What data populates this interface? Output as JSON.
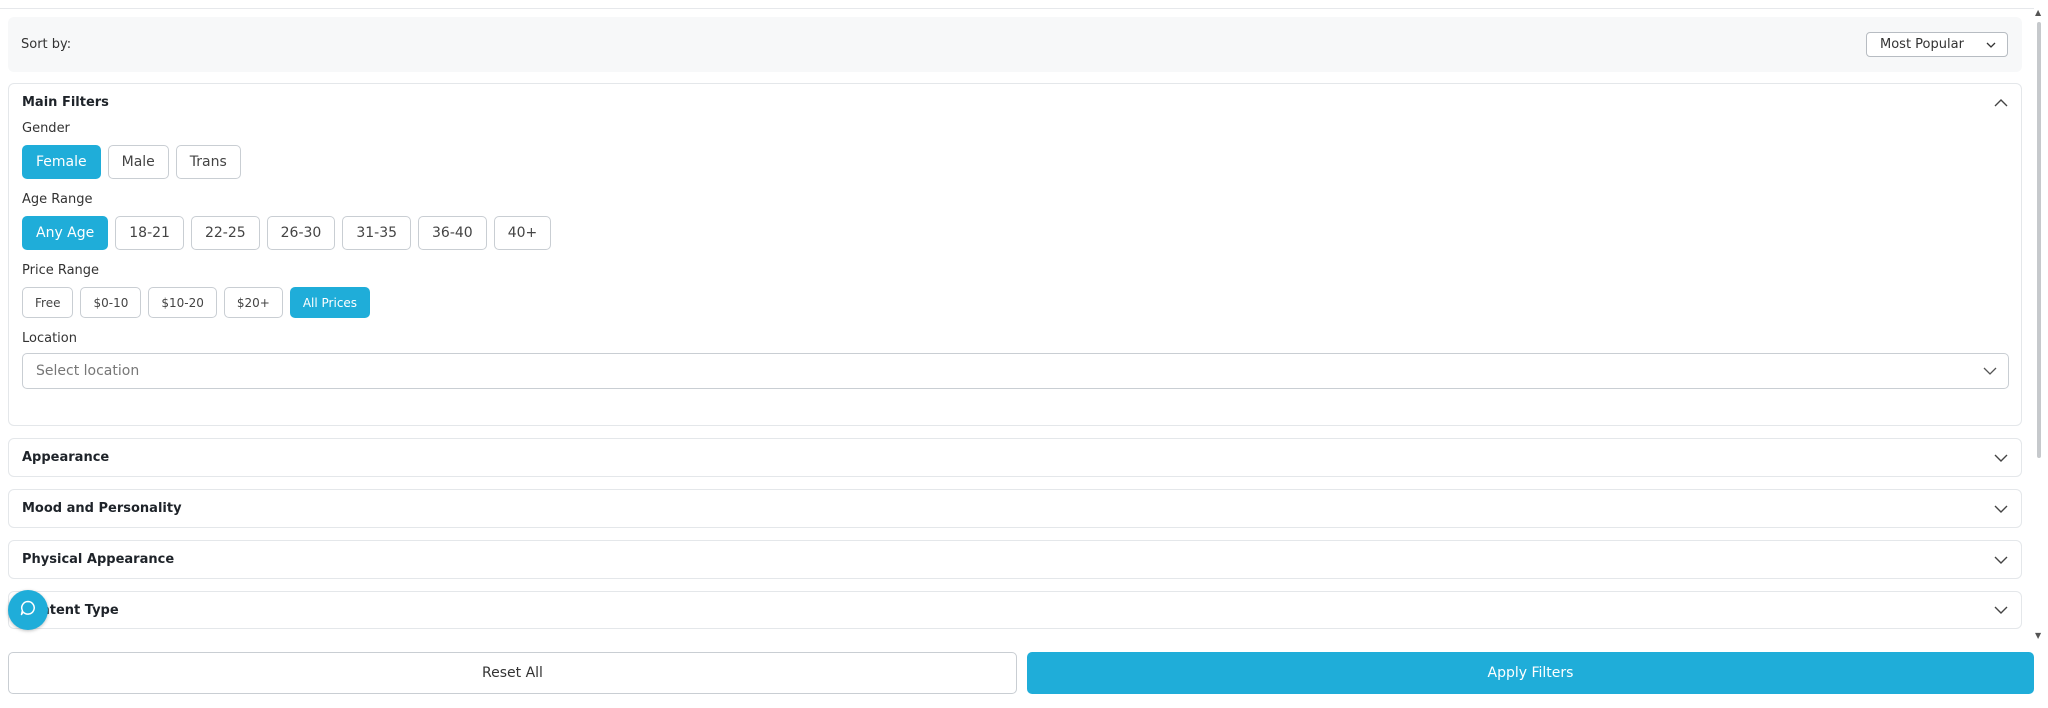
{
  "sort": {
    "label": "Sort by:",
    "selected": "Most Popular"
  },
  "main_filters": {
    "title": "Main Filters",
    "gender": {
      "label": "Gender",
      "options": [
        "Female",
        "Male",
        "Trans"
      ],
      "selected": "Female"
    },
    "age": {
      "label": "Age Range",
      "options": [
        "Any Age",
        "18-21",
        "22-25",
        "26-30",
        "31-35",
        "36-40",
        "40+"
      ],
      "selected": "Any Age"
    },
    "price": {
      "label": "Price Range",
      "options": [
        "Free",
        "$0-10",
        "$10-20",
        "$20+",
        "All Prices"
      ],
      "selected": "All Prices"
    },
    "location": {
      "label": "Location",
      "placeholder": "Select location"
    }
  },
  "sections": [
    "Appearance",
    "Mood and Personality",
    "Physical Appearance",
    "Content Type"
  ],
  "buttons": {
    "reset": "Reset All",
    "apply": "Apply Filters"
  },
  "colors": {
    "accent": "#1fadd9"
  },
  "icons": {
    "chat": "chat-bubble-icon",
    "collapse": "chevron-up-icon",
    "expand": "chevron-down-icon"
  }
}
